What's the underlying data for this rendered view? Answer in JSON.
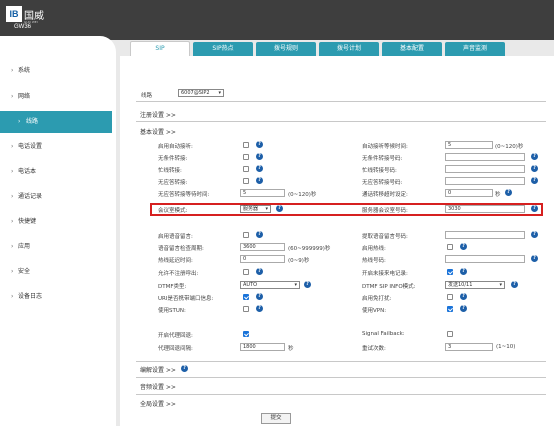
{
  "brand": {
    "logo_mark": "IB",
    "logo_cn": "国威",
    "logo_en": "GUO WEI",
    "model": "GW36"
  },
  "tabs": [
    {
      "label": "SIP",
      "active": true
    },
    {
      "label": "SIP热点"
    },
    {
      "label": "拨号规则"
    },
    {
      "label": "拨号计划"
    },
    {
      "label": "基本配置"
    },
    {
      "label": "声音监测"
    }
  ],
  "sidebar": [
    {
      "label": "系统"
    },
    {
      "label": "网络"
    },
    {
      "label": "线路",
      "active": true
    },
    {
      "label": "电话设置"
    },
    {
      "label": "电话本"
    },
    {
      "label": "通话记录"
    },
    {
      "label": "快捷键"
    },
    {
      "label": "应用"
    },
    {
      "label": "安全"
    },
    {
      "label": "设备日志"
    }
  ],
  "line": {
    "label": "线路",
    "value": "6007@SIP2"
  },
  "sections": {
    "register": "注册设置 >>",
    "basic": "基本设置 >>",
    "codec": "编解设置 >>",
    "video": "音频设置 >>",
    "global": "全局设置 >>"
  },
  "left_fields": [
    {
      "label": "启用自动接听:",
      "type": "checkbox",
      "checked": false
    },
    {
      "label": "无条件转接:",
      "type": "checkbox",
      "checked": false
    },
    {
      "label": "忙线转接:",
      "type": "checkbox",
      "checked": false
    },
    {
      "label": "无应答转接:",
      "type": "checkbox",
      "checked": false
    },
    {
      "label": "无应答转接等待时间:",
      "type": "input",
      "value": "5",
      "hint": "(0~120)秒"
    },
    {
      "label": "会议室模式:",
      "type": "select",
      "value": "服务器"
    }
  ],
  "right_fields": [
    {
      "label": "自动接听等候时间:",
      "type": "input",
      "value": "5",
      "hint": "(0~120)秒"
    },
    {
      "label": "无条件转接号码:",
      "type": "input",
      "value": ""
    },
    {
      "label": "忙线转接号码:",
      "type": "input",
      "value": ""
    },
    {
      "label": "无应答转接号码:",
      "type": "input",
      "value": ""
    },
    {
      "label": "通话转移超时设定:",
      "type": "input",
      "value": "0",
      "hint": "秒"
    },
    {
      "label": "服务器会议室号码:",
      "type": "input",
      "value": "3030"
    }
  ],
  "left_fields2": [
    {
      "label": "启用语音留言:",
      "type": "checkbox",
      "checked": false
    },
    {
      "label": "语音留言检查周期:",
      "type": "input",
      "value": "3600",
      "hint": "(60~999999)秒"
    },
    {
      "label": "热线延迟时间:",
      "type": "input",
      "value": "0",
      "hint": "(0~9)秒"
    },
    {
      "label": "允许不注册呼出:",
      "type": "checkbox",
      "checked": false
    },
    {
      "label": "DTMF类型:",
      "type": "select",
      "value": "AUTO"
    },
    {
      "label": "URI是否携带端口信息:",
      "type": "checkbox",
      "checked": true
    },
    {
      "label": "使用STUN:",
      "type": "checkbox",
      "checked": false
    }
  ],
  "right_fields2": [
    {
      "label": "提取语音留言号码:",
      "type": "input",
      "value": ""
    },
    {
      "label": "启用热线:",
      "type": "checkbox",
      "checked": false
    },
    {
      "label": "热线号码:",
      "type": "input",
      "value": ""
    },
    {
      "label": "开启未接来电记录:",
      "type": "checkbox",
      "checked": true
    },
    {
      "label": "DTMF SIP INFO模式:",
      "type": "select",
      "value": "发送10/11"
    },
    {
      "label": "启用免打扰:",
      "type": "checkbox",
      "checked": false
    },
    {
      "label": "使用VPN:",
      "type": "checkbox",
      "checked": true
    }
  ],
  "proxy": {
    "enable_label": "开启代理回退:",
    "enable_checked": true,
    "interval_label": "代理回退间隔:",
    "interval_value": "1800",
    "interval_unit": "秒",
    "signal_label": "Signal Failback:",
    "signal_checked": false,
    "retry_label": "重试次数:",
    "retry_value": "3",
    "retry_hint": "(1~10)"
  },
  "submit_label": "提交",
  "colors": {
    "accent": "#2c9bb0",
    "topbar": "#3e3e3e",
    "highlight": "#d62020",
    "help": "#1d5fa8"
  }
}
